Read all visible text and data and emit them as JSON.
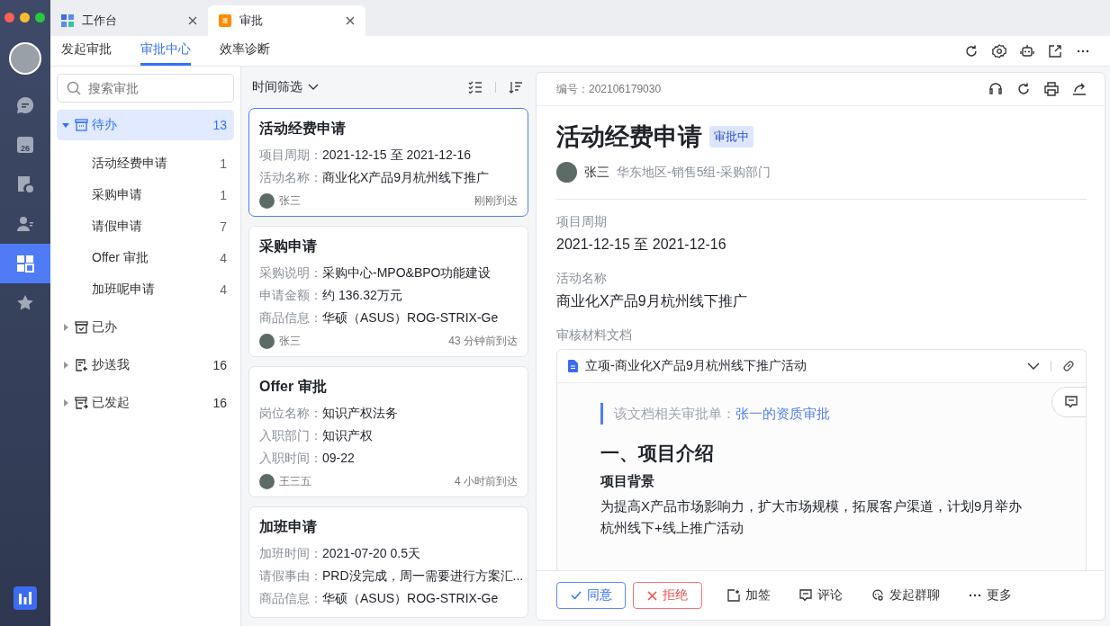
{
  "window": {
    "tabs": [
      {
        "label": "工作台",
        "kind": "grid",
        "selected": false
      },
      {
        "label": "审批",
        "kind": "stamp",
        "selected": true
      }
    ]
  },
  "rail": {
    "items": [
      {
        "kind": "chat",
        "selected": false
      },
      {
        "kind": "calendar",
        "label": "26",
        "selected": false
      },
      {
        "kind": "form",
        "selected": false
      },
      {
        "kind": "contacts",
        "selected": false
      },
      {
        "kind": "apps",
        "selected": true
      },
      {
        "kind": "star",
        "selected": false
      }
    ]
  },
  "nav_tabs": [
    {
      "label": "发起审批",
      "selected": false
    },
    {
      "label": "审批中心",
      "selected": true
    },
    {
      "label": "效率诊断",
      "selected": false
    }
  ],
  "sidebar": {
    "search": {
      "placeholder": "搜索审批"
    },
    "items": [
      {
        "label": "待办",
        "count": "13",
        "kind": "inbox",
        "expanded": true,
        "selected": true,
        "children": [
          {
            "label": "活动经费申请",
            "count": "1"
          },
          {
            "label": "采购申请",
            "count": "1"
          },
          {
            "label": "请假申请",
            "count": "7"
          },
          {
            "label": "Offer 审批",
            "count": "4"
          },
          {
            "label": "加班呢申请",
            "count": "4"
          }
        ]
      },
      {
        "label": "已办",
        "kind": "done",
        "expanded": false,
        "selected": false
      },
      {
        "label": "抄送我",
        "count": "16",
        "kind": "cc",
        "expanded": false,
        "selected": false
      },
      {
        "label": "已发起",
        "count": "16",
        "kind": "sent",
        "expanded": false,
        "selected": false
      }
    ]
  },
  "list": {
    "filter": "时间筛选",
    "cards": [
      {
        "title": "活动经费申请",
        "selected": true,
        "fields": [
          {
            "label": "项目周期：",
            "value": "2021-12-15 至 2021-12-16"
          },
          {
            "label": "活动名称：",
            "value": "商业化X产品9月杭州线下推广"
          }
        ],
        "author": "张三",
        "time": "刚刚到达"
      },
      {
        "title": "采购申请",
        "selected": false,
        "fields": [
          {
            "label": "采购说明：",
            "value": "采购中心-MPO&BPO功能建设"
          },
          {
            "label": "申请金额：",
            "value": "约 136.32万元"
          },
          {
            "label": "商品信息：",
            "value": "华硕（ASUS）ROG-STRIX-Ge"
          }
        ],
        "author": "张三",
        "time": "43 分钟前到达"
      },
      {
        "title": "Offer 审批",
        "selected": false,
        "fields": [
          {
            "label": "岗位名称：",
            "value": "知识产权法务"
          },
          {
            "label": "入职部门：",
            "value": "知识产权"
          },
          {
            "label": "入职时间：",
            "value": "09-22"
          }
        ],
        "author": "王三五",
        "time": "4 小时前到达"
      },
      {
        "title": "加班申请",
        "selected": false,
        "fields": [
          {
            "label": "加班时间：",
            "value": "2021-07-20  0.5天"
          },
          {
            "label": "请假事由：",
            "value": "PRD没完成，周一需要进行方案汇..."
          },
          {
            "label": "商品信息：",
            "value": "华硕（ASUS）ROG-STRIX-Ge"
          }
        ]
      }
    ]
  },
  "detail": {
    "number": "编号：202106179030",
    "title": "活动经费申请",
    "status": "审批中",
    "applicant": "张三",
    "department": "华东地区-销售5组-采购部门",
    "fields": [
      {
        "label": "项目周期",
        "value": "2021-12-15 至 2021-12-16"
      },
      {
        "label": "活动名称",
        "value": "商业化X产品9月杭州线下推广"
      }
    ],
    "docs_label": "审核材料文档",
    "document": {
      "title": "立项-商业化X产品9月杭州线下推广活动",
      "quote_label": "该文档相关审批单：",
      "quote_link": "张一的资质审批",
      "heading": "一、项目介绍",
      "subheading": "项目背景",
      "paragraph": "为提高X产品市场影响力，扩大市场规模，拓展客户渠道，计划9月举办杭州线下+线上推广活动"
    },
    "actions": [
      {
        "label": "同意",
        "kind": "approve"
      },
      {
        "label": "拒绝",
        "kind": "reject"
      },
      {
        "label": "加签",
        "kind": "add-sign"
      },
      {
        "label": "评论",
        "kind": "comment"
      },
      {
        "label": "发起群聊",
        "kind": "group"
      },
      {
        "label": "更多",
        "kind": "more"
      }
    ]
  }
}
